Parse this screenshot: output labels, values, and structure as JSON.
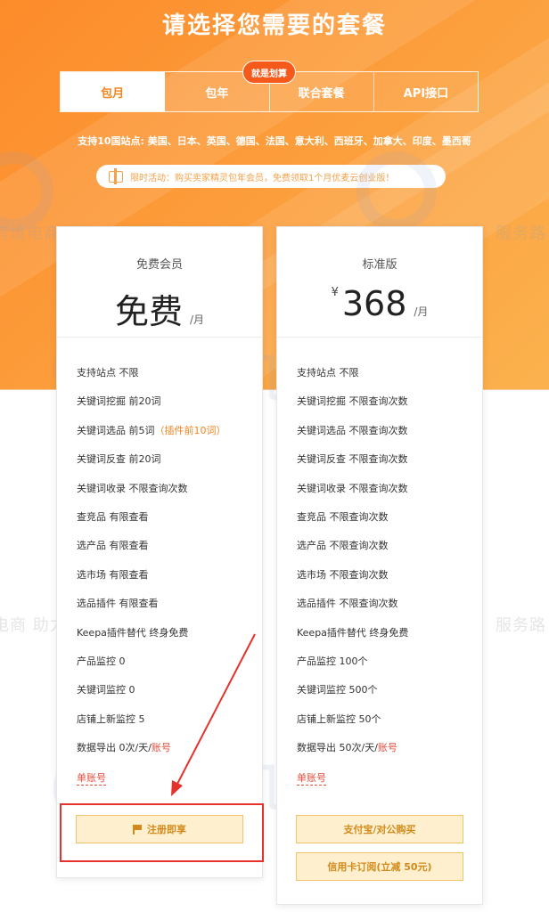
{
  "hero": {
    "title": "请选择您需要的套餐",
    "badge": "就是划算",
    "tabs": [
      {
        "label": "包月",
        "active": true
      },
      {
        "label": "包年",
        "active": false
      },
      {
        "label": "联合套餐",
        "active": false
      },
      {
        "label": "API接口",
        "active": false
      }
    ],
    "sites": "支持10国站点: 美国、日本、英国、德国、法国、意大利、西班牙、加拿大、印度、墨西哥",
    "promo": "限时活动：购买卖家精灵包年会员，免费领取1个月优麦云创业版！",
    "promo_icon": "gift-icon"
  },
  "watermark": {
    "brand": "主机侦探",
    "slogan": "服务跨境电商 助力中企出海",
    "slogan_short_a": "跨境电商 助力中企出海",
    "slogan_short_b": "电商 助力中企出海",
    "slogan_tail": "服务路"
  },
  "plans": {
    "free": {
      "name": "免费会员",
      "price": "免费",
      "unit": "/月",
      "features": [
        {
          "text": "支持站点 不限"
        },
        {
          "text": "关键词挖掘 前20词"
        },
        {
          "text": "关键词选品 前5词",
          "note": "（插件前10词）"
        },
        {
          "text": "关键词反查 前20词"
        },
        {
          "text": "关键词收录 不限查询次数"
        },
        {
          "text": "查竞品 有限查看"
        },
        {
          "text": "选产品 有限查看"
        },
        {
          "text": "选市场 有限查看"
        },
        {
          "text": "选品插件 有限查看"
        },
        {
          "text": "Keepa插件替代 终身免费"
        },
        {
          "text": "产品监控 0"
        },
        {
          "text": "关键词监控 0"
        },
        {
          "text": "店铺上新监控 5"
        },
        {
          "text": "数据导出 0次/天/",
          "acct": "账号"
        }
      ],
      "single": "单账号",
      "button": "注册即享"
    },
    "standard": {
      "name": "标准版",
      "currency": "¥",
      "price": "368",
      "unit": "/月",
      "features": [
        {
          "text": "支持站点 不限"
        },
        {
          "text": "关键词挖掘 不限查询次数"
        },
        {
          "text": "关键词选品 不限查询次数"
        },
        {
          "text": "关键词反查 不限查询次数"
        },
        {
          "text": "关键词收录 不限查询次数"
        },
        {
          "text": "查竞品 不限查询次数"
        },
        {
          "text": "选产品 不限查询次数"
        },
        {
          "text": "选市场 不限查询次数"
        },
        {
          "text": "选品插件 不限查询次数"
        },
        {
          "text": "Keepa插件替代 终身免费"
        },
        {
          "text": "产品监控 100个"
        },
        {
          "text": "关键词监控 500个"
        },
        {
          "text": "店铺上新监控 50个"
        },
        {
          "text": "数据导出 50次/天/",
          "acct": "账号"
        }
      ],
      "single": "单账号",
      "button_alipay": "支付宝/对公购买",
      "button_card": "信用卡订阅(立减 50元)"
    }
  },
  "colors": {
    "hero_orange": "#fd8b2a",
    "accent": "#f5831f",
    "badge": "#f55a1b",
    "annotation_red": "#e5322d",
    "button_bg": "#fef0cf"
  }
}
